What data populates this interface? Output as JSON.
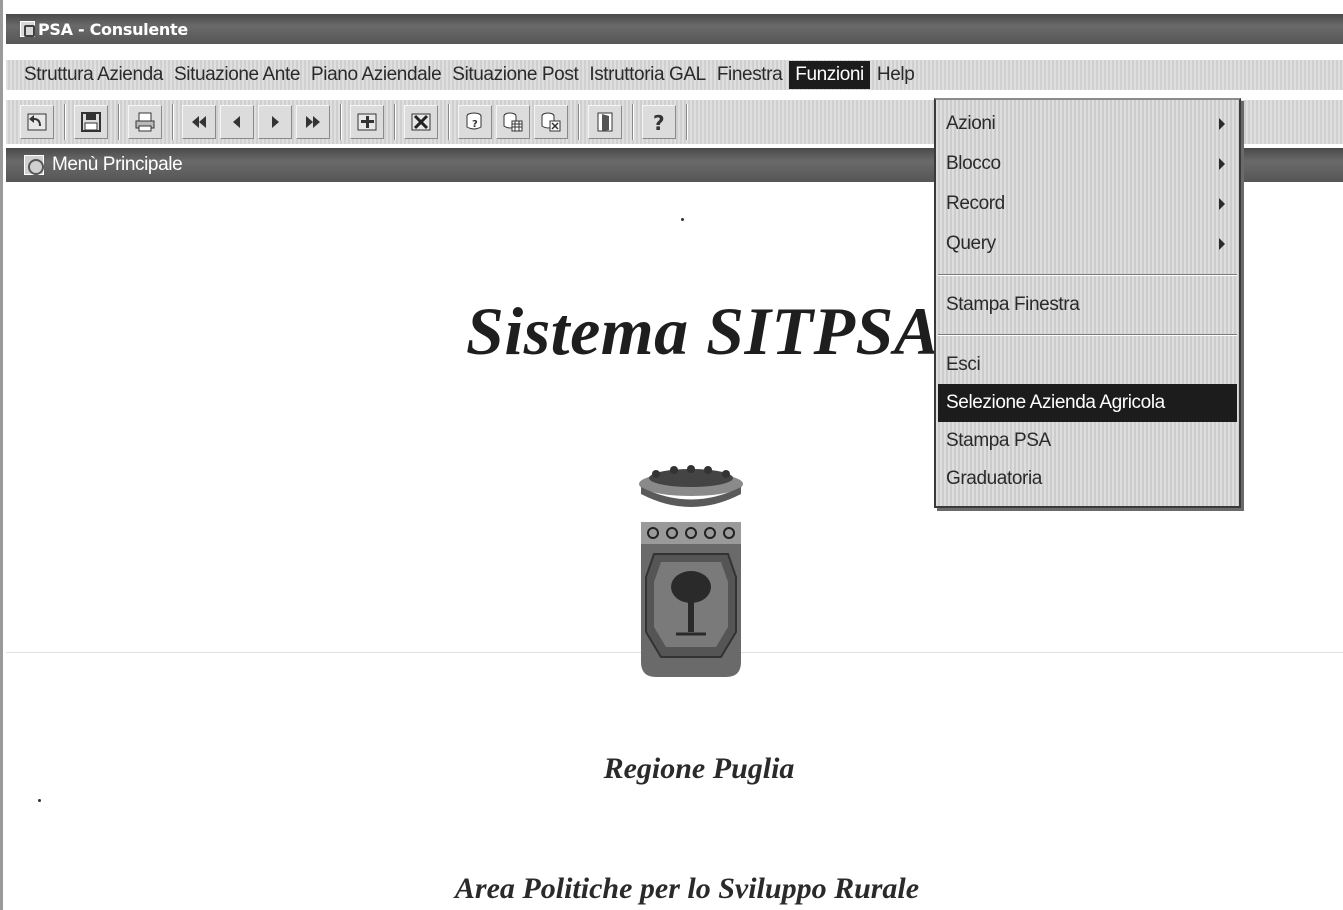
{
  "window": {
    "title": "PSA - Consulente"
  },
  "menubar": {
    "items": [
      "Struttura Azienda",
      "Situazione Ante",
      "Piano Aziendale",
      "Situazione Post",
      "Istruttoria GAL",
      "Finestra",
      "Funzioni",
      "Help"
    ],
    "active": "Funzioni"
  },
  "toolbar": {
    "buttons": [
      "undo-icon",
      "save-icon",
      "print-icon",
      "first-record-icon",
      "previous-record-icon",
      "next-record-icon",
      "last-record-icon",
      "insert-record-icon",
      "delete-record-icon",
      "query-icon",
      "execute-query-icon",
      "cancel-query-icon",
      "exit-icon",
      "help-icon"
    ]
  },
  "subwindow": {
    "title": "Menù Principale"
  },
  "content": {
    "main_title": "Sistema SITPSA",
    "region": "Regione Puglia",
    "area": "Area Politiche per lo Sviluppo Rurale"
  },
  "dropdown": {
    "items": [
      {
        "label": "Azioni",
        "submenu": true
      },
      {
        "label": "Blocco",
        "submenu": true
      },
      {
        "label": "Record",
        "submenu": true
      },
      {
        "label": "Query",
        "submenu": true
      },
      {
        "label": "Stampa Finestra",
        "submenu": false
      },
      {
        "label": "Esci",
        "submenu": false
      },
      {
        "label": "Selezione Azienda Agricola",
        "submenu": false,
        "selected": true
      },
      {
        "label": "Stampa PSA",
        "submenu": false
      },
      {
        "label": "Graduatoria",
        "submenu": false
      }
    ]
  },
  "colors": {
    "titlebar": "#565656",
    "menubar": "#d9d9d9",
    "highlight": "#1c1c1c"
  }
}
